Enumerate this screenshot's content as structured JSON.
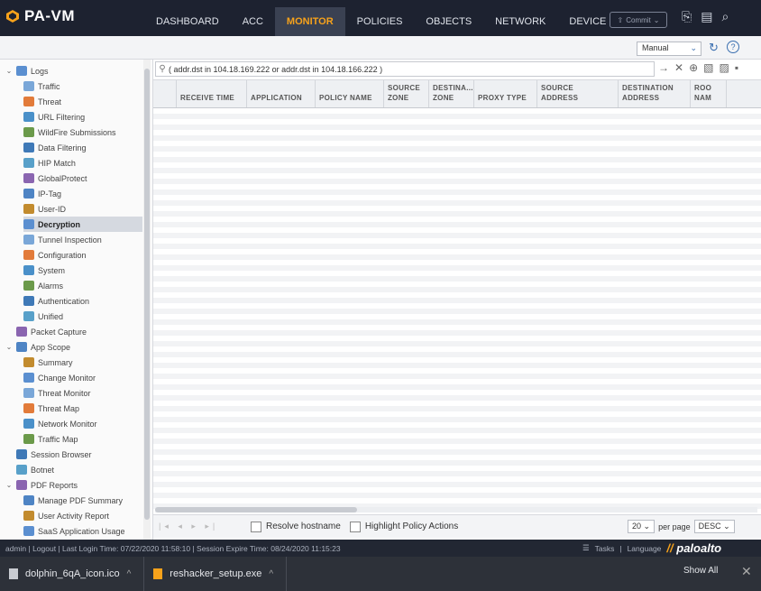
{
  "app": {
    "title": "PA-VM"
  },
  "nav": {
    "tabs": [
      "DASHBOARD",
      "ACC",
      "MONITOR",
      "POLICIES",
      "OBJECTS",
      "NETWORK",
      "DEVICE"
    ],
    "active_index": 2
  },
  "commit_label": "Commit",
  "toolbar": {
    "refresh_mode": "Manual"
  },
  "tree": [
    {
      "label": "Logs",
      "level": 0,
      "icon": "folder-icon",
      "expanded": true
    },
    {
      "label": "Traffic",
      "level": 1,
      "icon": "traffic-log-icon"
    },
    {
      "label": "Threat",
      "level": 1,
      "icon": "threat-log-icon"
    },
    {
      "label": "URL Filtering",
      "level": 1,
      "icon": "url-filtering-icon"
    },
    {
      "label": "WildFire Submissions",
      "level": 1,
      "icon": "wildfire-icon"
    },
    {
      "label": "Data Filtering",
      "level": 1,
      "icon": "data-filtering-icon"
    },
    {
      "label": "HIP Match",
      "level": 1,
      "icon": "hip-match-icon"
    },
    {
      "label": "GlobalProtect",
      "level": 1,
      "icon": "globalprotect-icon"
    },
    {
      "label": "IP-Tag",
      "level": 1,
      "icon": "ip-tag-icon"
    },
    {
      "label": "User-ID",
      "level": 1,
      "icon": "user-id-icon"
    },
    {
      "label": "Decryption",
      "level": 1,
      "icon": "decryption-icon",
      "selected": true
    },
    {
      "label": "Tunnel Inspection",
      "level": 1,
      "icon": "tunnel-icon"
    },
    {
      "label": "Configuration",
      "level": 1,
      "icon": "configuration-icon"
    },
    {
      "label": "System",
      "level": 1,
      "icon": "system-icon"
    },
    {
      "label": "Alarms",
      "level": 1,
      "icon": "alarms-icon"
    },
    {
      "label": "Authentication",
      "level": 1,
      "icon": "authentication-icon"
    },
    {
      "label": "Unified",
      "level": 1,
      "icon": "unified-icon"
    },
    {
      "label": "Packet Capture",
      "level": 0,
      "icon": "packet-capture-icon"
    },
    {
      "label": "App Scope",
      "level": 0,
      "icon": "app-scope-icon",
      "expanded": true
    },
    {
      "label": "Summary",
      "level": 1,
      "icon": "summary-icon"
    },
    {
      "label": "Change Monitor",
      "level": 1,
      "icon": "change-monitor-icon"
    },
    {
      "label": "Threat Monitor",
      "level": 1,
      "icon": "threat-monitor-icon"
    },
    {
      "label": "Threat Map",
      "level": 1,
      "icon": "threat-map-icon"
    },
    {
      "label": "Network Monitor",
      "level": 1,
      "icon": "network-monitor-icon"
    },
    {
      "label": "Traffic Map",
      "level": 1,
      "icon": "traffic-map-icon"
    },
    {
      "label": "Session Browser",
      "level": 0,
      "icon": "session-browser-icon"
    },
    {
      "label": "Botnet",
      "level": 0,
      "icon": "botnet-icon"
    },
    {
      "label": "PDF Reports",
      "level": 0,
      "icon": "pdf-reports-icon",
      "expanded": true
    },
    {
      "label": "Manage PDF Summary",
      "level": 1,
      "icon": "pdf-summary-icon"
    },
    {
      "label": "User Activity Report",
      "level": 1,
      "icon": "user-activity-icon"
    },
    {
      "label": "SaaS Application Usage",
      "level": 1,
      "icon": "saas-icon"
    }
  ],
  "filter": {
    "query": "( addr.dst in 104.18.169.222 or addr.dst in 104.18.166.222 )"
  },
  "table": {
    "columns": [
      [
        "",
        ""
      ],
      [
        "RECEIVE TIME",
        ""
      ],
      [
        "APPLICATION",
        ""
      ],
      [
        "POLICY NAME",
        ""
      ],
      [
        "SOURCE",
        "ZONE"
      ],
      [
        "DESTINA...",
        "ZONE"
      ],
      [
        "PROXY TYPE",
        ""
      ],
      [
        "SOURCE",
        "ADDRESS"
      ],
      [
        "DESTINATION",
        "ADDRESS"
      ],
      [
        "ROO",
        "NAM"
      ]
    ],
    "rows": []
  },
  "footer": {
    "resolve_hostname": "Resolve hostname",
    "highlight_policy": "Highlight Policy Actions",
    "page_size": "20",
    "per_page": "per page",
    "sort": "DESC"
  },
  "status": {
    "text": "admin | Logout | Last Login Time: 07/22/2020 11:58:10 | Session Expire Time: 08/24/2020 11:15:23",
    "tasks": "Tasks",
    "language": "Language"
  },
  "downloads": [
    {
      "name": "dolphin_6qA_icon.ico"
    },
    {
      "name": "reshacker_setup.exe"
    }
  ],
  "downloads_show_all": "Show All",
  "colors": {
    "accent": "#f7a21b",
    "header_bg": "#1d2230",
    "link_blue": "#3a6fb0"
  }
}
